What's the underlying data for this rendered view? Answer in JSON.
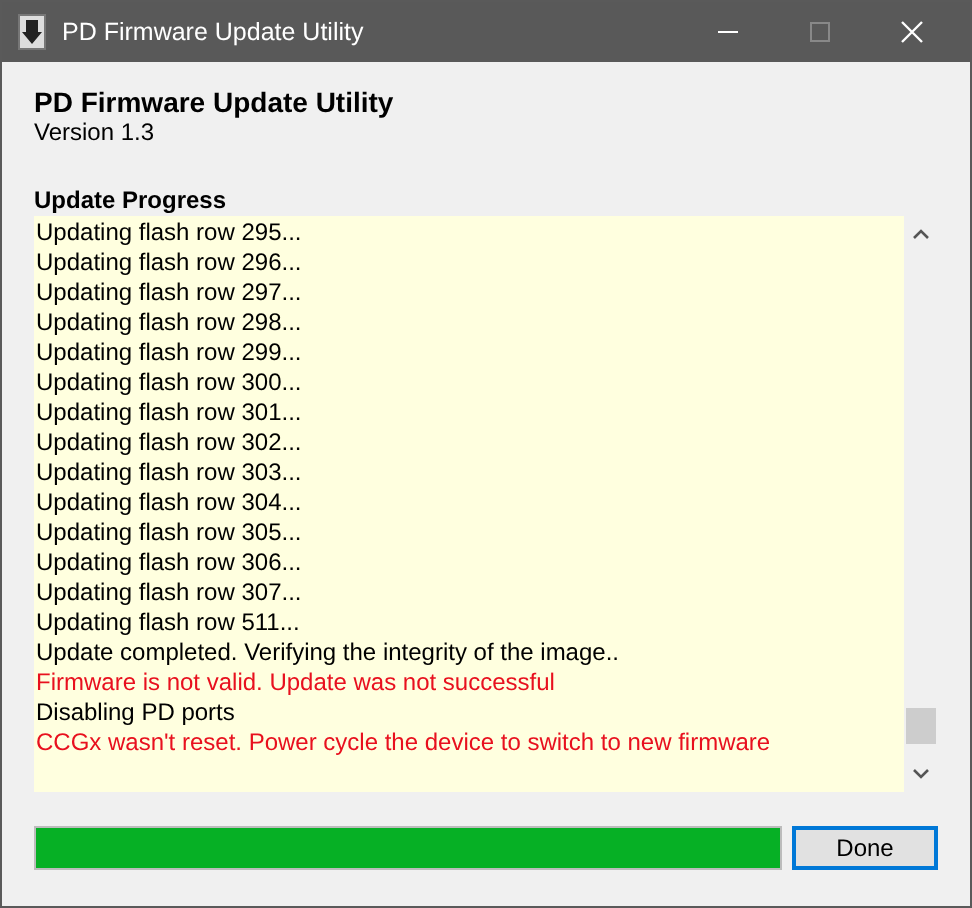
{
  "window": {
    "title": "PD Firmware Update Utility"
  },
  "header": {
    "title": "PD Firmware Update Utility",
    "version": "Version 1.3"
  },
  "log": {
    "label": "Update Progress",
    "lines": [
      {
        "text": "Updating flash row 295...",
        "kind": "info"
      },
      {
        "text": "Updating flash row 296...",
        "kind": "info"
      },
      {
        "text": "Updating flash row 297...",
        "kind": "info"
      },
      {
        "text": "Updating flash row 298...",
        "kind": "info"
      },
      {
        "text": "Updating flash row 299...",
        "kind": "info"
      },
      {
        "text": "Updating flash row 300...",
        "kind": "info"
      },
      {
        "text": "Updating flash row 301...",
        "kind": "info"
      },
      {
        "text": "Updating flash row 302...",
        "kind": "info"
      },
      {
        "text": "Updating flash row 303...",
        "kind": "info"
      },
      {
        "text": "Updating flash row 304...",
        "kind": "info"
      },
      {
        "text": "Updating flash row 305...",
        "kind": "info"
      },
      {
        "text": "Updating flash row 306...",
        "kind": "info"
      },
      {
        "text": "Updating flash row 307...",
        "kind": "info"
      },
      {
        "text": "Updating flash row 511...",
        "kind": "info"
      },
      {
        "text": "Update completed. Verifying the integrity of the image..",
        "kind": "info"
      },
      {
        "text": "Firmware is not valid. Update was not successful",
        "kind": "error"
      },
      {
        "text": "Disabling PD ports",
        "kind": "info"
      },
      {
        "text": "CCGx wasn't reset. Power cycle the device to switch to new firmware",
        "kind": "error"
      }
    ]
  },
  "progress": {
    "level": 1
  },
  "buttons": [
    {
      "label": "Done",
      "focused": true
    }
  ]
}
